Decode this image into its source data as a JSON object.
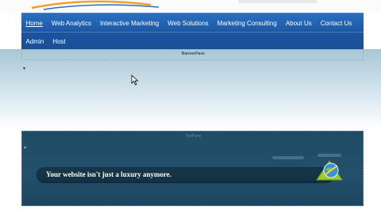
{
  "nav": {
    "row1": [
      "Home",
      "Web Analytics",
      "Interactive Marketing",
      "Web Solutions",
      "Marketing Consulting",
      "About Us",
      "Contact Us"
    ],
    "row2": [
      "Admin",
      "Host"
    ],
    "active": "Home"
  },
  "banner": {
    "pane_label": "BannerPane"
  },
  "top_pane": {
    "pane_label": "TopPane",
    "tagline": "Your website isn't just a luxury anymore."
  },
  "colors": {
    "nav_blue": "#1d5aa6",
    "pane_dark": "#224f6b",
    "globe_green": "#9ccc2a"
  },
  "icons": [
    "logo-swoosh",
    "mouse-cursor",
    "collapse-arrow",
    "globe-arrow-icon"
  ]
}
